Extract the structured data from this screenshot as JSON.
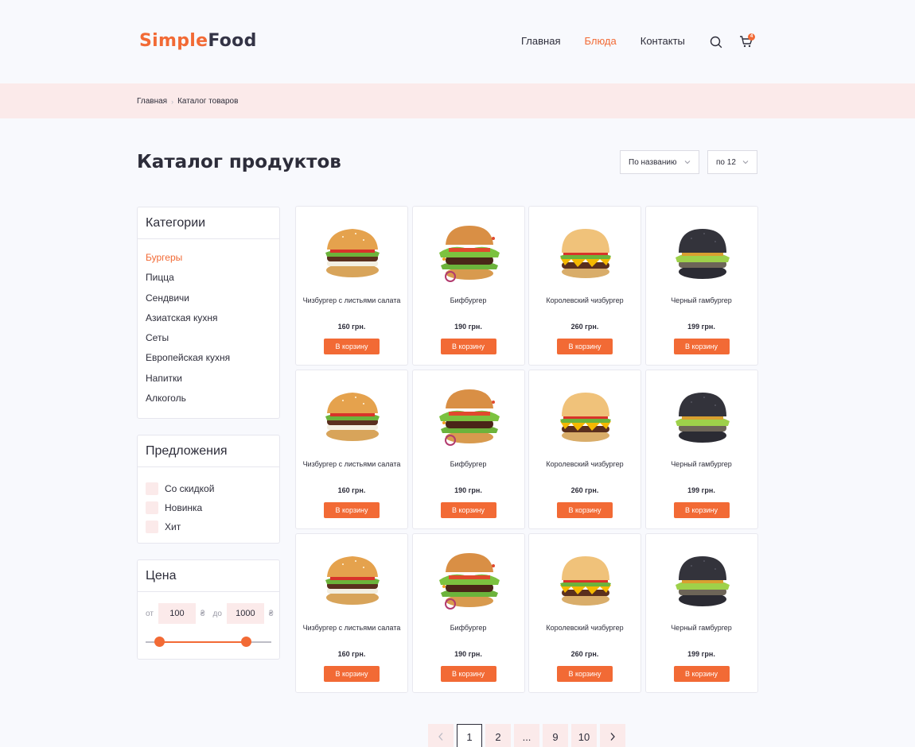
{
  "header": {
    "logo_part1": "Simple",
    "logo_part2": "Food",
    "nav": [
      {
        "label": "Главная",
        "active": false
      },
      {
        "label": "Блюда",
        "active": true
      },
      {
        "label": "Контакты",
        "active": false
      }
    ],
    "cart_count": "4"
  },
  "breadcrumb": [
    "Главная",
    "Каталог товаров"
  ],
  "page": {
    "title": "Каталог продуктов",
    "sort_label": "По названию",
    "per_page_label": "по 12"
  },
  "categories": {
    "title": "Категории",
    "items": [
      {
        "label": "Бургеры",
        "active": true
      },
      {
        "label": "Пицца",
        "active": false
      },
      {
        "label": "Сендвичи",
        "active": false
      },
      {
        "label": "Азиатская кухня",
        "active": false
      },
      {
        "label": "Сеты",
        "active": false
      },
      {
        "label": "Европейская кухня",
        "active": false
      },
      {
        "label": "Напитки",
        "active": false
      },
      {
        "label": "Алкоголь",
        "active": false
      }
    ]
  },
  "offers": {
    "title": "Предложения",
    "items": [
      "Со скидкой",
      "Новинка",
      "Хит"
    ]
  },
  "price": {
    "title": "Цена",
    "from_label": "от",
    "from_value": "100",
    "to_label": "до",
    "to_value": "1000",
    "currency": "₴"
  },
  "products": [
    {
      "name": "Чизбургер с листьями салата",
      "price": "160 грн.",
      "button": "В корзину",
      "icon": "cheeseburger-lettuce-image"
    },
    {
      "name": "Бифбургер",
      "price": "190 грн.",
      "button": "В корзину",
      "icon": "beefburger-image"
    },
    {
      "name": "Королевский чизбургер",
      "price": "260 грн.",
      "button": "В корзину",
      "icon": "royal-cheeseburger-image"
    },
    {
      "name": "Черный гамбургер",
      "price": "199 грн.",
      "button": "В корзину",
      "icon": "black-hamburger-image"
    },
    {
      "name": "Чизбургер с листьями салата",
      "price": "160 грн.",
      "button": "В корзину",
      "icon": "cheeseburger-lettuce-image"
    },
    {
      "name": "Бифбургер",
      "price": "190 грн.",
      "button": "В корзину",
      "icon": "beefburger-image"
    },
    {
      "name": "Королевский чизбургер",
      "price": "260 грн.",
      "button": "В корзину",
      "icon": "royal-cheeseburger-image"
    },
    {
      "name": "Черный гамбургер",
      "price": "199 грн.",
      "button": "В корзину",
      "icon": "black-hamburger-image"
    },
    {
      "name": "Чизбургер с листьями салата",
      "price": "160 грн.",
      "button": "В корзину",
      "icon": "cheeseburger-lettuce-image"
    },
    {
      "name": "Бифбургер",
      "price": "190 грн.",
      "button": "В корзину",
      "icon": "beefburger-image"
    },
    {
      "name": "Королевский чизбургер",
      "price": "260 грн.",
      "button": "В корзину",
      "icon": "royal-cheeseburger-image"
    },
    {
      "name": "Черный гамбургер",
      "price": "199 грн.",
      "button": "В корзину",
      "icon": "black-hamburger-image"
    }
  ],
  "pagination": {
    "pages": [
      "1",
      "2",
      "...",
      "9",
      "10"
    ],
    "current": "1"
  },
  "colors": {
    "accent": "#f26a35",
    "dark": "#2d2d3a",
    "pink_bg": "#fbeaea",
    "page_bg": "#f8f9fd"
  }
}
